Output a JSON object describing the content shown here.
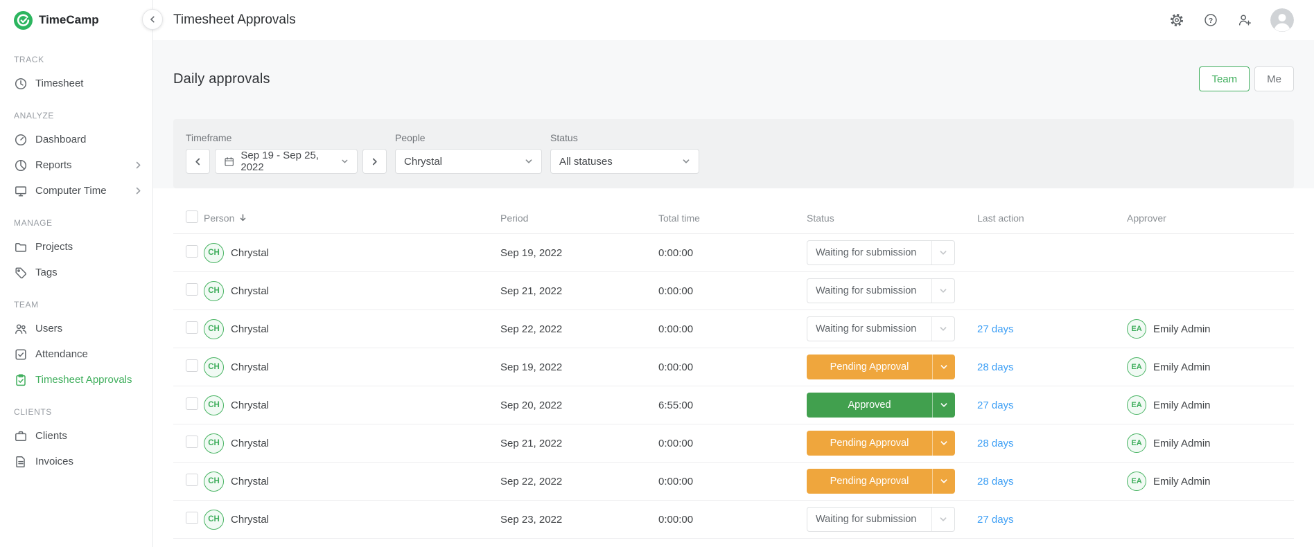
{
  "brand": {
    "name": "TimeCamp"
  },
  "header": {
    "title": "Timesheet Approvals"
  },
  "sidebar": {
    "sections": [
      {
        "label": "TRACK",
        "items": [
          {
            "label": "Timesheet",
            "icon": "clock-icon",
            "active": false,
            "chevron": false
          }
        ]
      },
      {
        "label": "ANALYZE",
        "items": [
          {
            "label": "Dashboard",
            "icon": "dashboard-icon",
            "active": false,
            "chevron": false
          },
          {
            "label": "Reports",
            "icon": "reports-icon",
            "active": false,
            "chevron": true
          },
          {
            "label": "Computer Time",
            "icon": "computer-icon",
            "active": false,
            "chevron": true
          }
        ]
      },
      {
        "label": "MANAGE",
        "items": [
          {
            "label": "Projects",
            "icon": "projects-icon",
            "active": false,
            "chevron": false
          },
          {
            "label": "Tags",
            "icon": "tags-icon",
            "active": false,
            "chevron": false
          }
        ]
      },
      {
        "label": "TEAM",
        "items": [
          {
            "label": "Users",
            "icon": "users-icon",
            "active": false,
            "chevron": false
          },
          {
            "label": "Attendance",
            "icon": "attendance-icon",
            "active": false,
            "chevron": false
          },
          {
            "label": "Timesheet Approvals",
            "icon": "approvals-icon",
            "active": true,
            "chevron": false
          }
        ]
      },
      {
        "label": "CLIENTS",
        "items": [
          {
            "label": "Clients",
            "icon": "clients-icon",
            "active": false,
            "chevron": false
          },
          {
            "label": "Invoices",
            "icon": "invoices-icon",
            "active": false,
            "chevron": false
          }
        ]
      }
    ]
  },
  "page": {
    "heading": "Daily approvals",
    "view_toggle": {
      "options": [
        "Team",
        "Me"
      ],
      "selected": "Team"
    }
  },
  "filters": {
    "timeframe": {
      "label": "Timeframe",
      "value": "Sep 19 - Sep 25, 2022"
    },
    "people": {
      "label": "People",
      "value": "Chrystal"
    },
    "status": {
      "label": "Status",
      "value": "All statuses"
    }
  },
  "table": {
    "columns": [
      "Person",
      "Period",
      "Total time",
      "Status",
      "Last action",
      "Approver"
    ],
    "rows": [
      {
        "person_initials": "CH",
        "person": "Chrystal",
        "period": "Sep 19, 2022",
        "total_time": "0:00:00",
        "status": "Waiting for submission",
        "status_type": "waiting",
        "last_action": "",
        "approver_initials": "",
        "approver": ""
      },
      {
        "person_initials": "CH",
        "person": "Chrystal",
        "period": "Sep 21, 2022",
        "total_time": "0:00:00",
        "status": "Waiting for submission",
        "status_type": "waiting",
        "last_action": "",
        "approver_initials": "",
        "approver": ""
      },
      {
        "person_initials": "CH",
        "person": "Chrystal",
        "period": "Sep 22, 2022",
        "total_time": "0:00:00",
        "status": "Waiting for submission",
        "status_type": "waiting",
        "last_action": "27 days",
        "approver_initials": "EA",
        "approver": "Emily Admin"
      },
      {
        "person_initials": "CH",
        "person": "Chrystal",
        "period": "Sep 19, 2022",
        "total_time": "0:00:00",
        "status": "Pending Approval",
        "status_type": "pending",
        "last_action": "28 days",
        "approver_initials": "EA",
        "approver": "Emily Admin"
      },
      {
        "person_initials": "CH",
        "person": "Chrystal",
        "period": "Sep 20, 2022",
        "total_time": "6:55:00",
        "status": "Approved",
        "status_type": "approved",
        "last_action": "27 days",
        "approver_initials": "EA",
        "approver": "Emily Admin"
      },
      {
        "person_initials": "CH",
        "person": "Chrystal",
        "period": "Sep 21, 2022",
        "total_time": "0:00:00",
        "status": "Pending Approval",
        "status_type": "pending",
        "last_action": "28 days",
        "approver_initials": "EA",
        "approver": "Emily Admin"
      },
      {
        "person_initials": "CH",
        "person": "Chrystal",
        "period": "Sep 22, 2022",
        "total_time": "0:00:00",
        "status": "Pending Approval",
        "status_type": "pending",
        "last_action": "28 days",
        "approver_initials": "EA",
        "approver": "Emily Admin"
      },
      {
        "person_initials": "CH",
        "person": "Chrystal",
        "period": "Sep 23, 2022",
        "total_time": "0:00:00",
        "status": "Waiting for submission",
        "status_type": "waiting",
        "last_action": "27 days",
        "approver_initials": "",
        "approver": ""
      }
    ]
  },
  "colors": {
    "brand_green": "#2cb55f",
    "active_green": "#3fae5c",
    "approved_green": "#41a04e",
    "pending_orange": "#efa63d",
    "link_blue": "#3b9ef5"
  }
}
